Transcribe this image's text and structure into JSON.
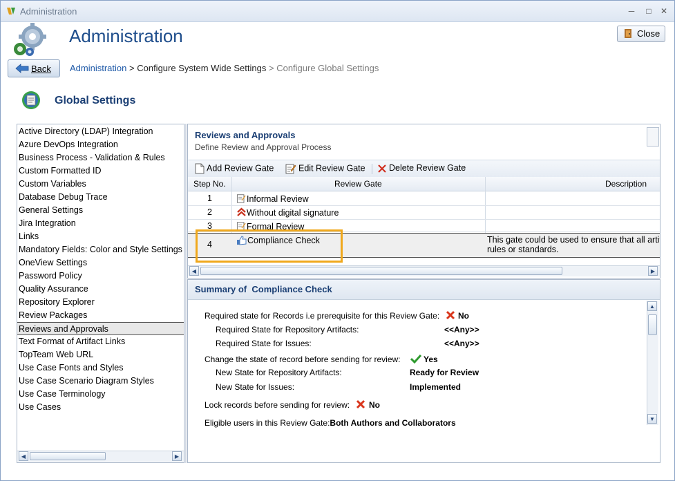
{
  "window": {
    "title": "Administration"
  },
  "header": {
    "title": "Administration",
    "close_label": "Close",
    "back_label": "Back",
    "breadcrumb": {
      "root": "Administration",
      "sep": ">",
      "middle": "Configure System Wide Settings",
      "current": "Configure Global Settings"
    }
  },
  "section_title": "Global Settings",
  "settings_list": [
    "Active Directory (LDAP) Integration",
    "Azure DevOps Integration",
    "Business Process - Validation & Rules",
    "Custom Formatted ID",
    "Custom Variables",
    "Database Debug Trace",
    "General Settings",
    "Jira Integration",
    "Links",
    "Mandatory Fields: Color and Style Settings",
    "OneView Settings",
    "Password Policy",
    "Quality Assurance",
    "Repository Explorer",
    "Review Packages",
    "Reviews and Approvals",
    "Text Format of Artifact Links",
    "TopTeam Web URL",
    "Use Case Fonts and Styles",
    "Use Case Scenario Diagram Styles",
    "Use Case Terminology",
    "Use Cases"
  ],
  "selected_setting": "Reviews and Approvals",
  "reviews": {
    "title": "Reviews and Approvals",
    "subtitle": "Define Review and Approval Process",
    "toolbar": {
      "add": "Add Review Gate",
      "edit": "Edit Review Gate",
      "delete": "Delete Review Gate"
    },
    "columns": {
      "step": "Step No.",
      "gate": "Review Gate",
      "description": "Description"
    },
    "rows": [
      {
        "step": "1",
        "gate": "Informal Review",
        "icon": "edit-note-icon",
        "description": ""
      },
      {
        "step": "2",
        "gate": "Without digital signature",
        "icon": "double-chevron-up-icon",
        "description": ""
      },
      {
        "step": "3",
        "gate": "Formal Review",
        "icon": "edit-note-icon",
        "description": ""
      },
      {
        "step": "4",
        "gate": "Compliance Check",
        "icon": "thumbs-up-icon",
        "description_line1": "This gate could be used to ensure that all artif",
        "description_line2": "rules or standards."
      }
    ]
  },
  "summary": {
    "prefix": "Summary of",
    "name": "Compliance Check",
    "required_state_label": "Required state for Records i.e prerequisite for this Review Gate:",
    "required_state_value": "No",
    "req_artifacts_label": "Required State for Repository Artifacts:",
    "req_artifacts_value": "<<Any>>",
    "req_issues_label": "Required State for Issues:",
    "req_issues_value": "<<Any>>",
    "change_state_label": "Change the state of record before sending for review:",
    "change_state_value": "Yes",
    "new_artifacts_label": "New State for Repository Artifacts:",
    "new_artifacts_value": "Ready for Review",
    "new_issues_label": "New State for Issues:",
    "new_issues_value": "Implemented",
    "lock_label": "Lock records before sending for review:",
    "lock_value": "No",
    "eligible_label": "Eligible users in this Review Gate:",
    "eligible_value": "Both Authors and Collaborators"
  },
  "colors": {
    "accent": "#1f4e8c",
    "highlight": "#f0a81c",
    "no": "#d9361c",
    "yes": "#2f9a2f"
  }
}
